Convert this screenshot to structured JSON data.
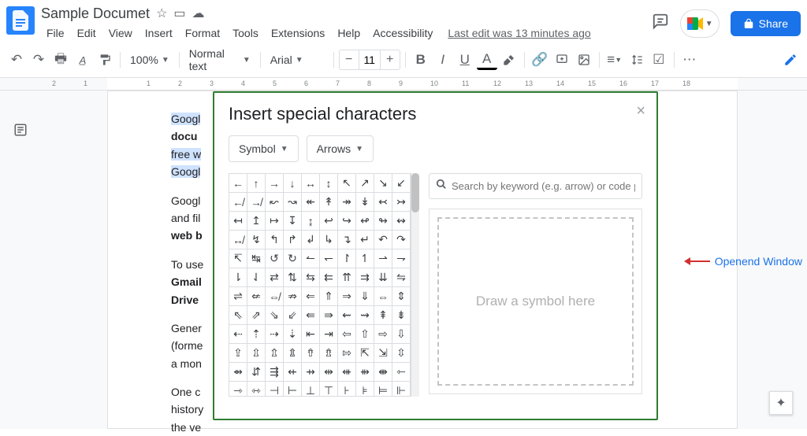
{
  "header": {
    "doc_title": "Sample Documet",
    "menus": [
      "File",
      "Edit",
      "View",
      "Insert",
      "Format",
      "Tools",
      "Extensions",
      "Help",
      "Accessibility"
    ],
    "last_edit": "Last edit was 13 minutes ago",
    "share_label": "Share"
  },
  "toolbar": {
    "zoom": "100%",
    "style": "Normal text",
    "font": "Arial",
    "font_size": "11"
  },
  "ruler": {
    "ticks": [
      "2",
      "1",
      "1",
      "2",
      "3",
      "4",
      "5",
      "6",
      "7",
      "8",
      "9",
      "10",
      "11",
      "12",
      "13",
      "14",
      "15",
      "16",
      "17",
      "18"
    ]
  },
  "doc": {
    "p1a": "Googl",
    "p1b": "docu",
    "p1c": "free w",
    "p1d": "Googl",
    "p2a": "Googl",
    "p2b": "and fil",
    "p2c": "web b",
    "p3a": "To use",
    "p3b": "Gmail",
    "p3c": "Drive",
    "p4a": "Gener",
    "p4b": "(forme",
    "p4c": "a mon",
    "p5a": "One c",
    "p5b": "history",
    "p5c": "the ve"
  },
  "dialog": {
    "title": "Insert special characters",
    "category": "Symbol",
    "subcategory": "Arrows",
    "search_placeholder": "Search by keyword (e.g. arrow) or code point",
    "draw_hint": "Draw a symbol here",
    "chars": [
      "←",
      "↑",
      "→",
      "↓",
      "↔",
      "↕",
      "↖",
      "↗",
      "↘",
      "↙",
      "↚",
      "↛",
      "↜",
      "↝",
      "↞",
      "↟",
      "↠",
      "↡",
      "↢",
      "↣",
      "↤",
      "↥",
      "↦",
      "↧",
      "↨",
      "↩",
      "↪",
      "↫",
      "↬",
      "↭",
      "↮",
      "↯",
      "↰",
      "↱",
      "↲",
      "↳",
      "↴",
      "↵",
      "↶",
      "↷",
      "↸",
      "↹",
      "↺",
      "↻",
      "↼",
      "↽",
      "↾",
      "↿",
      "⇀",
      "⇁",
      "⇂",
      "⇃",
      "⇄",
      "⇅",
      "⇆",
      "⇇",
      "⇈",
      "⇉",
      "⇊",
      "⇋",
      "⇌",
      "⇍",
      "⇎",
      "⇏",
      "⇐",
      "⇑",
      "⇒",
      "⇓",
      "⇔",
      "⇕",
      "⇖",
      "⇗",
      "⇘",
      "⇙",
      "⇚",
      "⇛",
      "⇜",
      "⇝",
      "⇞",
      "⇟",
      "⇠",
      "⇡",
      "⇢",
      "⇣",
      "⇤",
      "⇥",
      "⇦",
      "⇧",
      "⇨",
      "⇩",
      "⇪",
      "⇫",
      "⇬",
      "⇭",
      "⇮",
      "⇯",
      "⇰",
      "⇱",
      "⇲",
      "⇳",
      "⇴",
      "⇵",
      "⇶",
      "⇷",
      "⇸",
      "⇹",
      "⇺",
      "⇻",
      "⇼",
      "⇽",
      "⇾",
      "⇿",
      "⊣",
      "⊢",
      "⊥",
      "⊤",
      "⊦",
      "⊧",
      "⊨",
      "⊩"
    ]
  },
  "annotation": {
    "label": "Openend Window"
  }
}
